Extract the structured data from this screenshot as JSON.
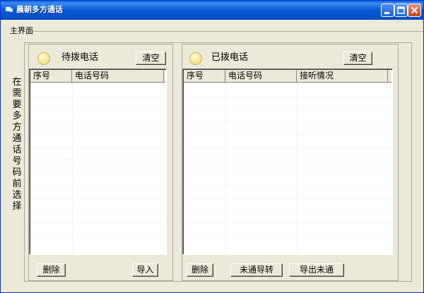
{
  "window": {
    "title": "晨朝多方通话",
    "controls": [
      "minimize-icon",
      "maximize-icon",
      "close-icon"
    ]
  },
  "menu": {
    "main": "主界面"
  },
  "side_hint": "在需要多方通话号码前选择",
  "pending": {
    "title": "待拨电话",
    "clear_label": "清空",
    "columns": [
      "序号",
      "电话号码"
    ],
    "delete_label": "删除",
    "import_label": "导入"
  },
  "dialed": {
    "title": "已拨电话",
    "clear_label": "清空",
    "columns": [
      "序号",
      "电话号码",
      "接听情况"
    ],
    "delete_label": "删除",
    "transfer_label": "未通导转",
    "export_label": "导出未通"
  },
  "colors": {
    "title_bar": "#0859d6",
    "window_bg": "#ece9d8",
    "indicator": "#f6e27a"
  }
}
